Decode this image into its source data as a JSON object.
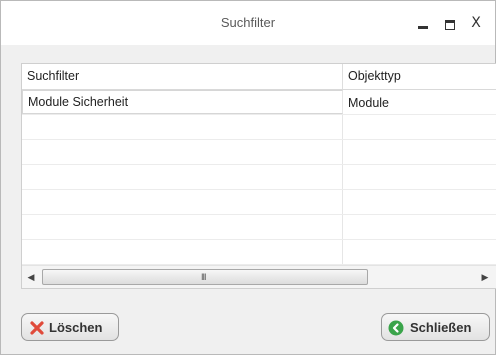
{
  "window": {
    "title": "Suchfilter",
    "controls": {
      "minimize": "_",
      "maximize": "□",
      "close": "X"
    }
  },
  "table": {
    "columns": [
      "Suchfilter",
      "Objekttyp"
    ],
    "rows": [
      [
        "Module Sicherheit",
        "Module"
      ],
      [
        "",
        ""
      ],
      [
        "",
        ""
      ],
      [
        "",
        ""
      ],
      [
        "",
        ""
      ],
      [
        "",
        ""
      ],
      [
        "",
        ""
      ],
      [
        "",
        ""
      ]
    ],
    "scrollbar_grip": "III"
  },
  "buttons": {
    "delete_label": "Löschen",
    "close_label": "Schließen"
  },
  "icons": {
    "delete": "red-x-icon",
    "close": "green-arrow-circle-icon"
  },
  "colors": {
    "delete_icon": "#e04b3b",
    "close_icon": "#3aa44a"
  }
}
